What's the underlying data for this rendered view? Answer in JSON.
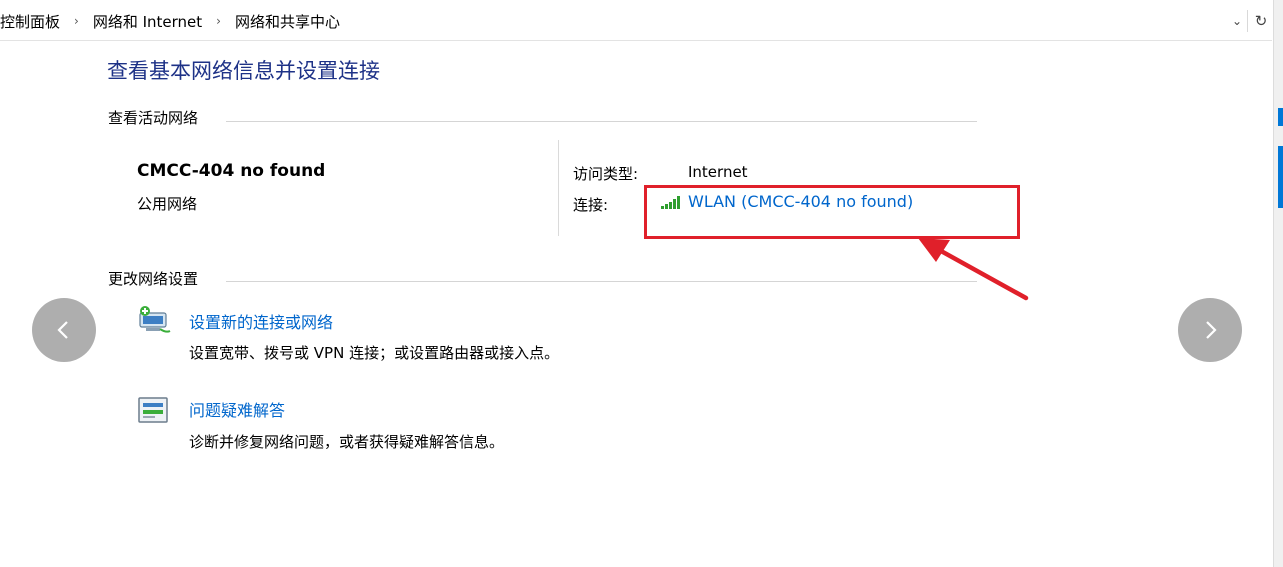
{
  "breadcrumb": {
    "items": [
      "控制面板",
      "网络和 Internet",
      "网络和共享中心"
    ],
    "separator": "›",
    "dropdown_icon": "chevron-down-icon",
    "refresh_icon": "refresh-icon"
  },
  "page_title": "查看基本网络信息并设置连接",
  "active_networks": {
    "heading": "查看活动网络",
    "network_name": "CMCC-404 no found",
    "network_type": "公用网络",
    "access_type_label": "访问类型:",
    "access_type_value": "Internet",
    "connection_label": "连接:",
    "connection_value": "WLAN (CMCC-404 no found)",
    "signal_icon": "wifi-signal-icon",
    "signal_color": "#2e9e2e"
  },
  "change_settings": {
    "heading": "更改网络设置",
    "items": [
      {
        "link": "设置新的连接或网络",
        "desc": "设置宽带、拨号或 VPN 连接；或设置路由器或接入点。",
        "icon": "new-connection-icon"
      },
      {
        "link": "问题疑难解答",
        "desc": "诊断并修复网络问题，或者获得疑难解答信息。",
        "icon": "troubleshoot-icon"
      }
    ]
  },
  "annotation": {
    "color": "#e0202a"
  },
  "nav": {
    "prev_icon": "chevron-left-icon",
    "next_icon": "chevron-right-icon"
  },
  "colors": {
    "title": "#1e3287",
    "link": "#0066cc"
  }
}
